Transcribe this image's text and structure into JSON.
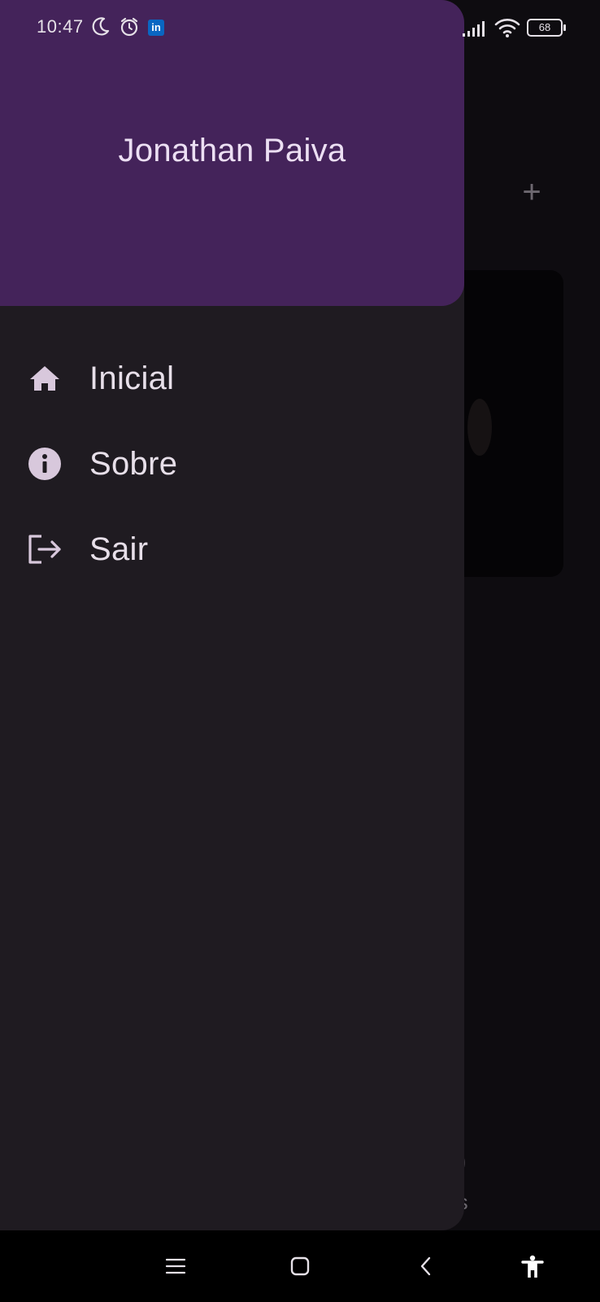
{
  "status_bar": {
    "time": "10:47",
    "icons": [
      "moon-icon",
      "alarm-icon",
      "linkedin-icon",
      "signal-icon",
      "wifi-icon"
    ],
    "linkedin_label": "in",
    "battery_level": "68"
  },
  "drawer": {
    "user_name": "Jonathan Paiva",
    "items": [
      {
        "label": "Inicial",
        "icon": "home-icon"
      },
      {
        "label": "Sobre",
        "icon": "info-icon"
      },
      {
        "label": "Sair",
        "icon": "logout-icon"
      }
    ],
    "colors": {
      "header_bg": "#44235a",
      "drawer_bg": "#1f1b21",
      "text": "#e7dfe9",
      "icon": "#d8c8dc"
    }
  },
  "background_app": {
    "add_symbol": "+",
    "nav_label_partial": "tos"
  },
  "system_nav": {
    "buttons": [
      "menu-icon",
      "home-square-icon",
      "back-icon",
      "accessibility-icon"
    ]
  }
}
